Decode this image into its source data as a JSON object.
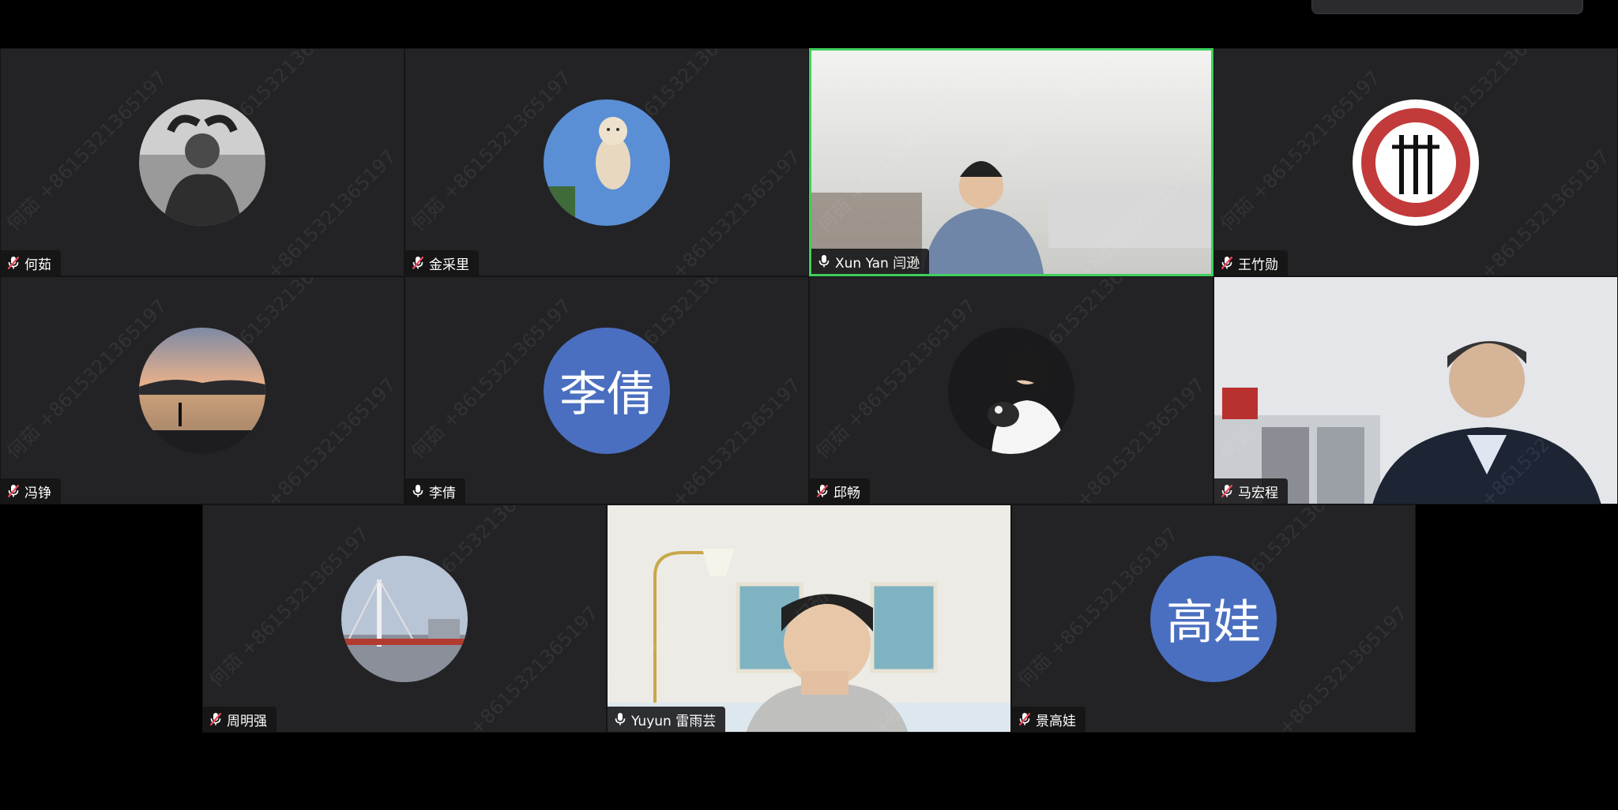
{
  "colors": {
    "tile_bg": "#232326",
    "active_speaker_border": "#3fcf5c",
    "muted_mic": "#e9475a",
    "initials_avatar": "#4a6fc0"
  },
  "watermark": "何茹 +8615321365197",
  "participants": [
    {
      "name": "何茹",
      "mic": "muted",
      "display": "photo-avatar",
      "icon": "person-photo"
    },
    {
      "name": "金采里",
      "mic": "muted",
      "display": "photo-avatar",
      "icon": "dog-photo"
    },
    {
      "name": "Xun Yan 闫逊",
      "mic": "on",
      "display": "video",
      "active_speaker": true
    },
    {
      "name": "王竹勋",
      "mic": "muted",
      "display": "photo-avatar",
      "icon": "logo-photo"
    },
    {
      "name": "冯铮",
      "mic": "muted",
      "display": "photo-avatar",
      "icon": "sunset-photo"
    },
    {
      "name": "李倩",
      "mic": "on",
      "display": "initials",
      "initials": "李倩"
    },
    {
      "name": "邱畅",
      "mic": "muted",
      "display": "photo-avatar",
      "icon": "portrait-photo"
    },
    {
      "name": "马宏程",
      "mic": "muted",
      "display": "video"
    },
    {
      "name": "周明强",
      "mic": "muted",
      "display": "photo-avatar",
      "icon": "bridge-photo"
    },
    {
      "name": "Yuyun 雷雨芸",
      "mic": "on",
      "display": "video"
    },
    {
      "name": "景高娃",
      "mic": "muted",
      "display": "initials",
      "initials": "高娃"
    }
  ]
}
